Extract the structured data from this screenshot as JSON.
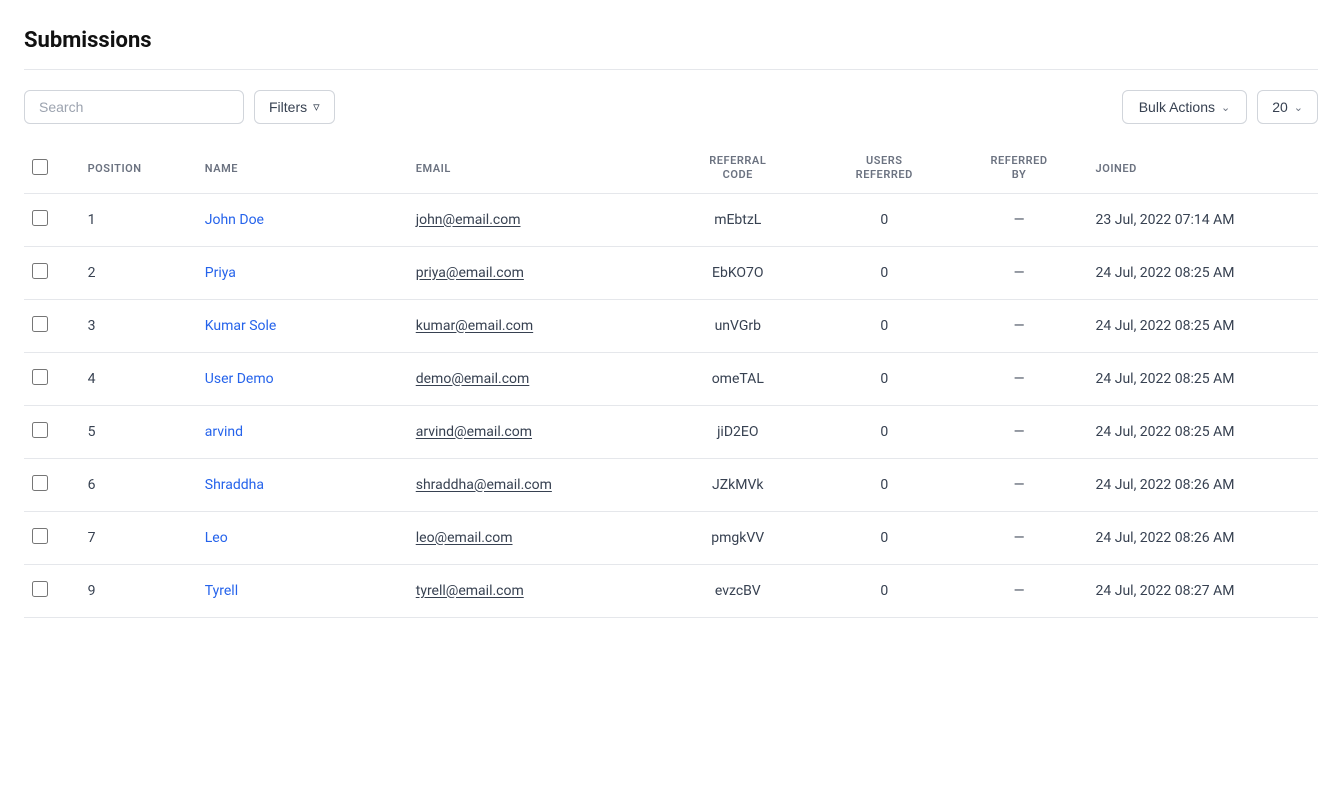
{
  "page": {
    "title": "Submissions"
  },
  "toolbar": {
    "search_placeholder": "Search",
    "filters_label": "Filters",
    "bulk_actions_label": "Bulk Actions",
    "per_page_value": "20"
  },
  "table": {
    "columns": [
      {
        "key": "checkbox",
        "label": ""
      },
      {
        "key": "position",
        "label": "POSITION"
      },
      {
        "key": "name",
        "label": "NAME"
      },
      {
        "key": "email",
        "label": "EMAIL"
      },
      {
        "key": "referral_code",
        "label": "REFERRAL CODE"
      },
      {
        "key": "users_referred",
        "label": "USERS REFERRED"
      },
      {
        "key": "referred_by",
        "label": "REFERRED BY"
      },
      {
        "key": "joined",
        "label": "JOINED"
      }
    ],
    "rows": [
      {
        "position": "1",
        "name": "John Doe",
        "email": "john@email.com",
        "referral_code": "mEbtzL",
        "users_referred": "0",
        "referred_by": "—",
        "joined": "23 Jul, 2022 07:14 AM"
      },
      {
        "position": "2",
        "name": "Priya",
        "email": "priya@email.com",
        "referral_code": "EbKO7O",
        "users_referred": "0",
        "referred_by": "—",
        "joined": "24 Jul, 2022 08:25 AM"
      },
      {
        "position": "3",
        "name": "Kumar Sole",
        "email": "kumar@email.com",
        "referral_code": "unVGrb",
        "users_referred": "0",
        "referred_by": "—",
        "joined": "24 Jul, 2022 08:25 AM"
      },
      {
        "position": "4",
        "name": "User Demo",
        "email": "demo@email.com",
        "referral_code": "omeTAL",
        "users_referred": "0",
        "referred_by": "—",
        "joined": "24 Jul, 2022 08:25 AM"
      },
      {
        "position": "5",
        "name": "arvind",
        "email": "arvind@email.com",
        "referral_code": "jiD2EO",
        "users_referred": "0",
        "referred_by": "—",
        "joined": "24 Jul, 2022 08:25 AM"
      },
      {
        "position": "6",
        "name": "Shraddha",
        "email": "shraddha@email.com",
        "referral_code": "JZkMVk",
        "users_referred": "0",
        "referred_by": "—",
        "joined": "24 Jul, 2022 08:26 AM"
      },
      {
        "position": "7",
        "name": "Leo",
        "email": "leo@email.com",
        "referral_code": "pmgkVV",
        "users_referred": "0",
        "referred_by": "—",
        "joined": "24 Jul, 2022 08:26 AM"
      },
      {
        "position": "9",
        "name": "Tyrell",
        "email": "tyrell@email.com",
        "referral_code": "evzcBV",
        "users_referred": "0",
        "referred_by": "—",
        "joined": "24 Jul, 2022 08:27 AM"
      }
    ]
  }
}
